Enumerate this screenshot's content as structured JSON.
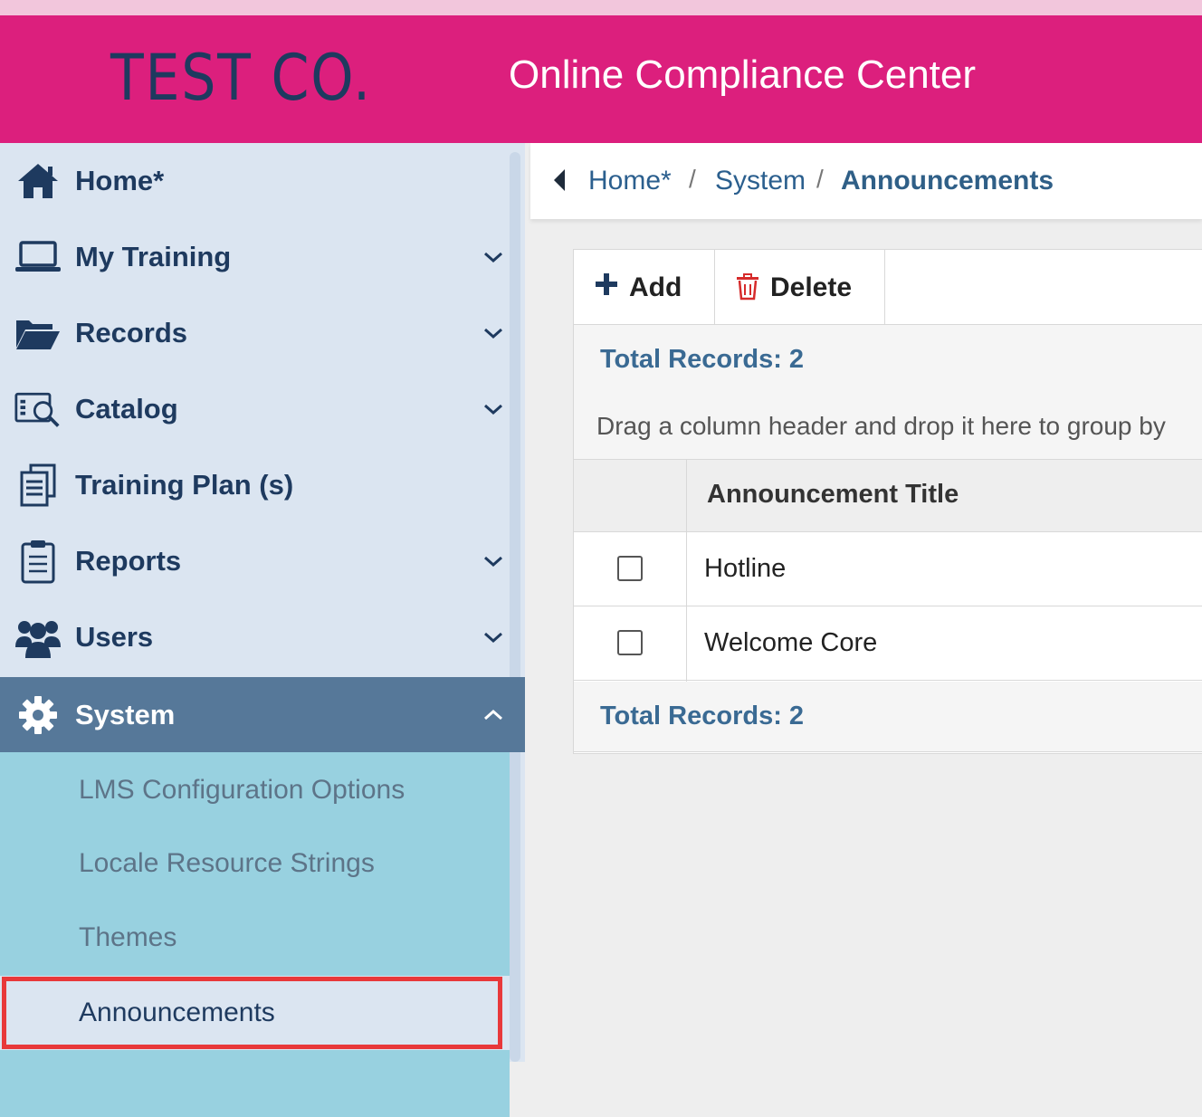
{
  "header": {
    "brand": "TEST CO.",
    "app_title": "Online Compliance Center"
  },
  "sidebar": {
    "items": [
      {
        "label": "Home*",
        "icon": "home-icon"
      },
      {
        "label": "My Training",
        "icon": "laptop-icon"
      },
      {
        "label": "Records",
        "icon": "folder-open-icon"
      },
      {
        "label": "Catalog",
        "icon": "catalog-search-icon"
      },
      {
        "label": "Training Plan (s)",
        "icon": "document-stack-icon"
      },
      {
        "label": "Reports",
        "icon": "clipboard-icon"
      },
      {
        "label": "Users",
        "icon": "users-icon"
      },
      {
        "label": "System",
        "icon": "gear-icon"
      }
    ],
    "submenu": [
      {
        "label": "LMS Configuration Options"
      },
      {
        "label": "Locale Resource Strings"
      },
      {
        "label": "Themes"
      },
      {
        "label": "Announcements"
      }
    ]
  },
  "breadcrumb": {
    "home": "Home*",
    "sep": "/",
    "system": "System",
    "current": "Announcements"
  },
  "toolbar": {
    "add_label": "Add",
    "delete_label": "Delete"
  },
  "grid": {
    "total_top": "Total Records: 2",
    "group_hint": "Drag a column header and drop it here to group by",
    "column_title": "Announcement Title",
    "rows": [
      {
        "title": "Hotline",
        "checked": false
      },
      {
        "title": "Welcome Core",
        "checked": false
      }
    ],
    "total_bottom": "Total Records: 2"
  },
  "colors": {
    "header_bg": "#dc1f7d",
    "brand_text": "#1e3a5f",
    "sidebar_bg": "#dbe5f1",
    "active_nav": "#567899",
    "submenu_bg": "#98d1e0",
    "highlight_box": "#e8383a"
  }
}
